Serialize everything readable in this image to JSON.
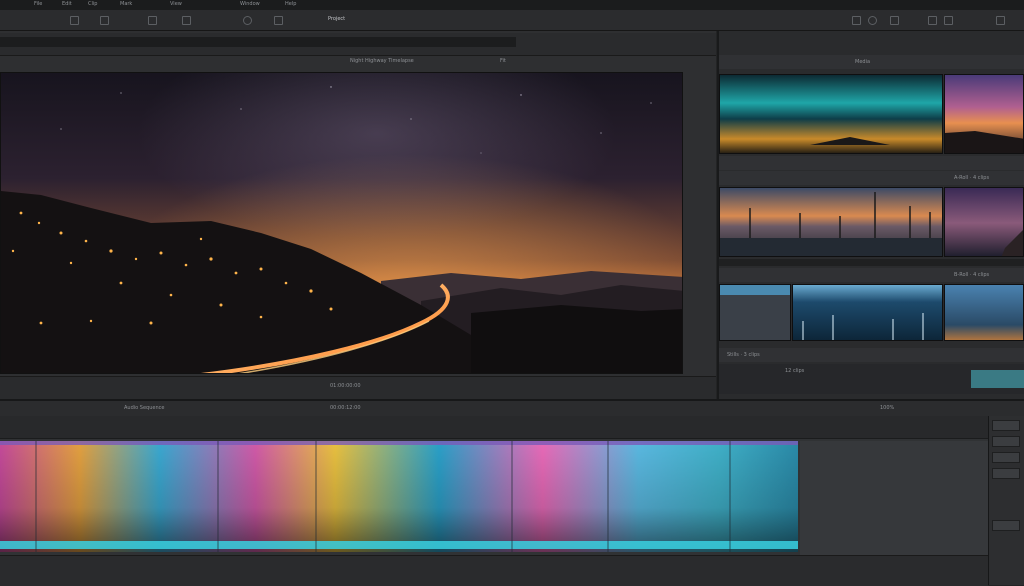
{
  "app": {
    "menu": [
      "File",
      "Edit",
      "Clip",
      "Mark",
      "View",
      "Window",
      "Help"
    ],
    "toolbar_title": "Project"
  },
  "viewer": {
    "title": "Night Highway Timelapse",
    "zoom": "Fit",
    "timecode": "01:00:00:00"
  },
  "browser": {
    "header_label": "Media",
    "sections": [
      {
        "label": "A-Roll · 4 clips"
      },
      {
        "label": "B-Roll · 4 clips"
      },
      {
        "label": "Stills · 3 clips"
      }
    ],
    "footer_label": "12 clips"
  },
  "timeline": {
    "sequence_name": "Audio Sequence",
    "timecode": "00:00:12:00",
    "zoom": "100%"
  },
  "colors": {
    "accent": "#3a7a84",
    "panel": "#2e2f31",
    "background": "#232425"
  }
}
